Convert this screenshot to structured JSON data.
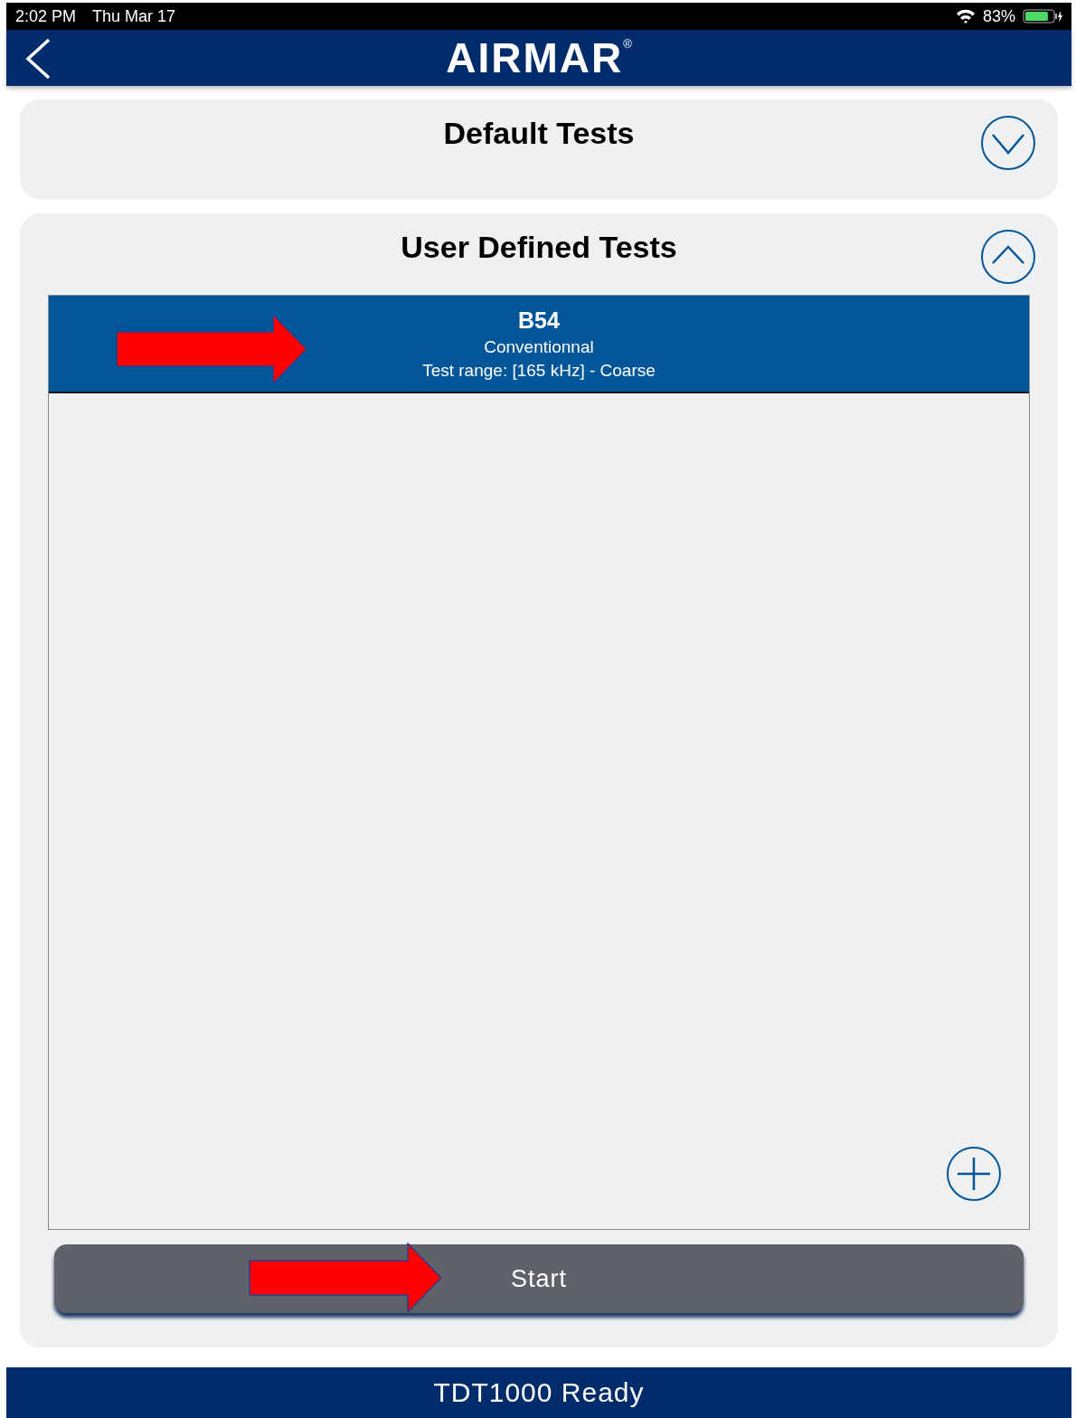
{
  "status_bar": {
    "time": "2:02 PM",
    "date": "Thu Mar 17",
    "battery_text": "83%",
    "battery": {
      "level": 0.83
    }
  },
  "header": {
    "logo": "AIRMAR",
    "logo_mark": "®"
  },
  "sections": [
    {
      "title": "Default Tests",
      "expanded": false
    },
    {
      "title": "User Defined Tests",
      "expanded": true,
      "tests": [
        {
          "name": "B54",
          "type": "Conventionnal",
          "range": "Test range: [165 kHz] - Coarse",
          "selected": true
        }
      ]
    }
  ],
  "start_button": "Start",
  "footer": "TDT1000 Ready"
}
